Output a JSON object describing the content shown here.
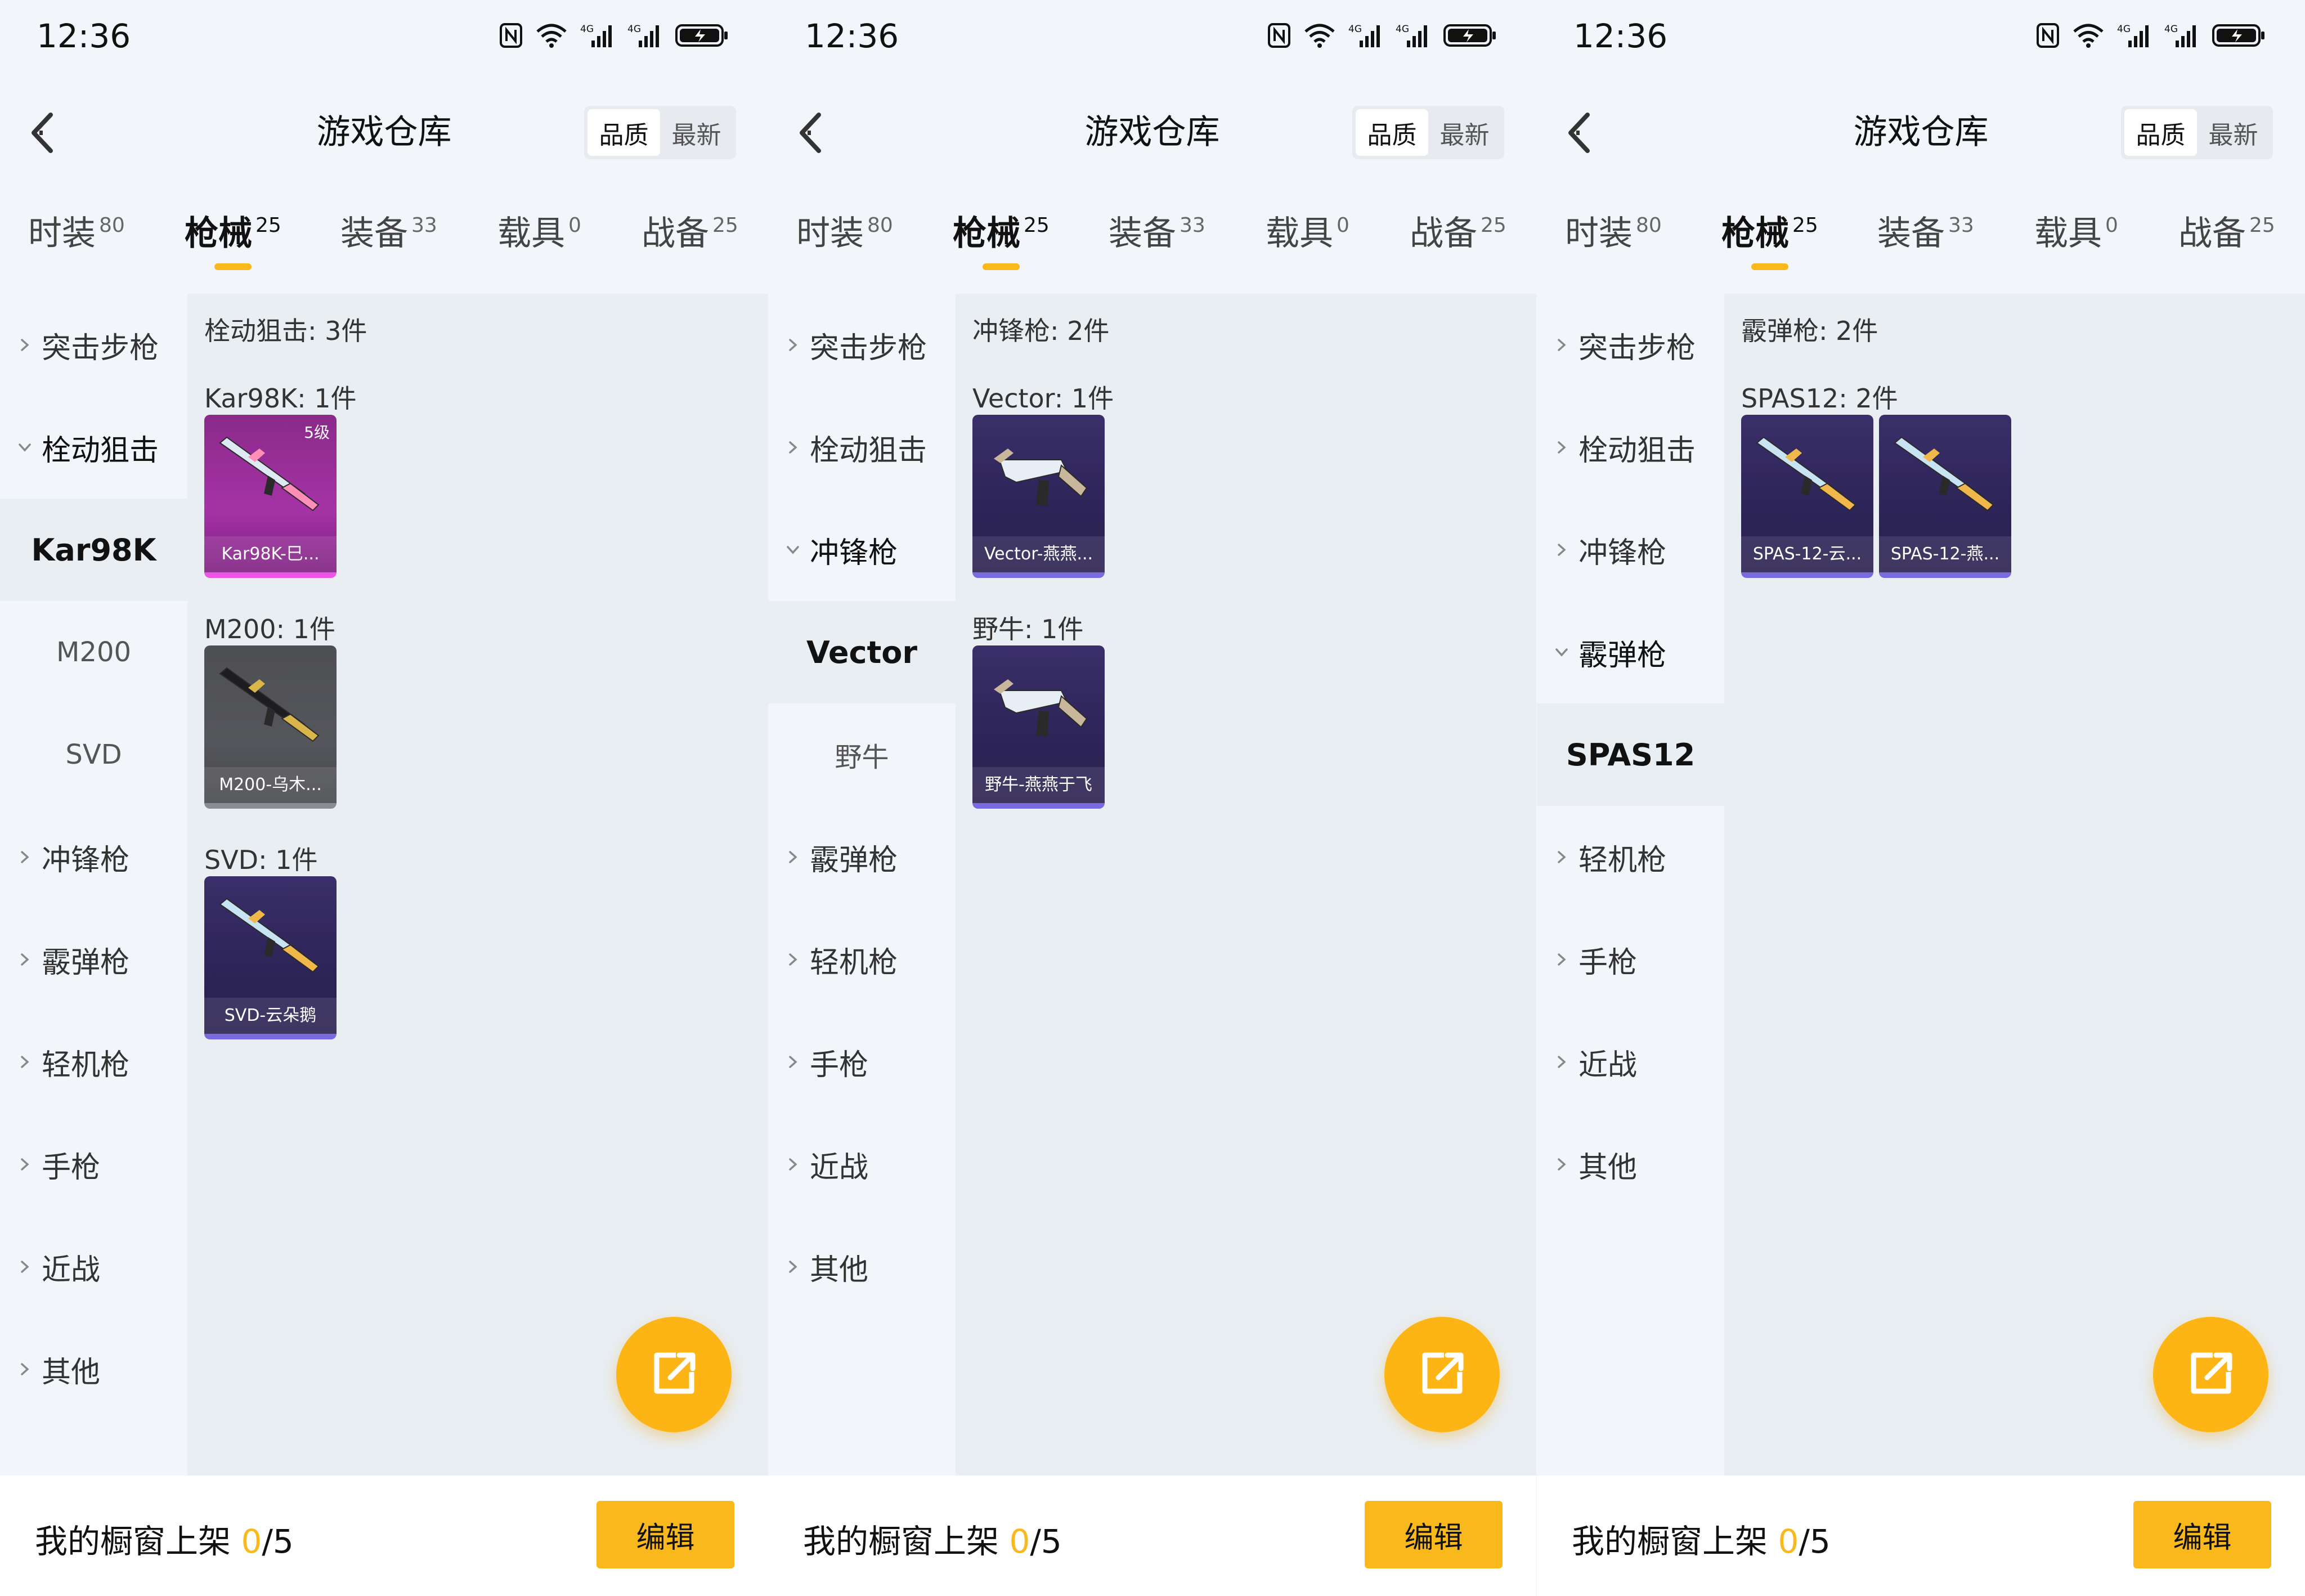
{
  "status_bar": {
    "time": "12:36",
    "net1": "4G",
    "net2": "4G"
  },
  "nav": {
    "title": "游戏仓库",
    "sort_quality": "品质",
    "sort_latest": "最新"
  },
  "tabs": [
    {
      "label": "时装",
      "count": "80"
    },
    {
      "label": "枪械",
      "count": "25"
    },
    {
      "label": "装备",
      "count": "33"
    },
    {
      "label": "载具",
      "count": "0"
    },
    {
      "label": "战备",
      "count": "25"
    }
  ],
  "categories": {
    "assault": "突击步枪",
    "bolt": "栓动狙击",
    "smg": "冲锋枪",
    "shotgun": "霰弹枪",
    "lmg": "轻机枪",
    "pistol": "手枪",
    "melee": "近战",
    "other": "其他"
  },
  "screen1": {
    "sub": [
      "Kar98K",
      "M200",
      "SVD"
    ],
    "content_title": "栓动狙击: 3件",
    "groups": [
      {
        "title": "Kar98K: 1件",
        "card": "Kar98K-巳...",
        "level": "5级"
      },
      {
        "title": "M200: 1件",
        "card": "M200-乌木..."
      },
      {
        "title": "SVD: 1件",
        "card": "SVD-云朵鹅"
      }
    ]
  },
  "screen2": {
    "sub": [
      "Vector",
      "野牛"
    ],
    "content_title": "冲锋枪: 2件",
    "groups": [
      {
        "title": "Vector: 1件",
        "card": "Vector-燕燕..."
      },
      {
        "title": "野牛: 1件",
        "card": "野牛-燕燕于飞"
      }
    ]
  },
  "screen3": {
    "sub": [
      "SPAS12"
    ],
    "content_title": "霰弹枪: 2件",
    "groups": [
      {
        "title": "SPAS12: 2件",
        "cards": [
          "SPAS-12-云...",
          "SPAS-12-燕..."
        ]
      }
    ]
  },
  "bottom": {
    "text": "我的橱窗上架",
    "current": "0",
    "total": "/5",
    "edit": "编辑"
  },
  "colors": {
    "accent": "#f9b81b",
    "content_bg": "#e9eef3",
    "page_bg": "#f2f6fa",
    "card_purple": "#2d2457",
    "card_magenta": "#a533a5",
    "card_gray": "#55565b"
  },
  "icons": {
    "back": "chevron-left-icon",
    "share": "share-external-icon",
    "nfc": "nfc-icon",
    "wifi": "wifi-icon",
    "signal": "signal-icon",
    "battery": "battery-charging-icon"
  }
}
